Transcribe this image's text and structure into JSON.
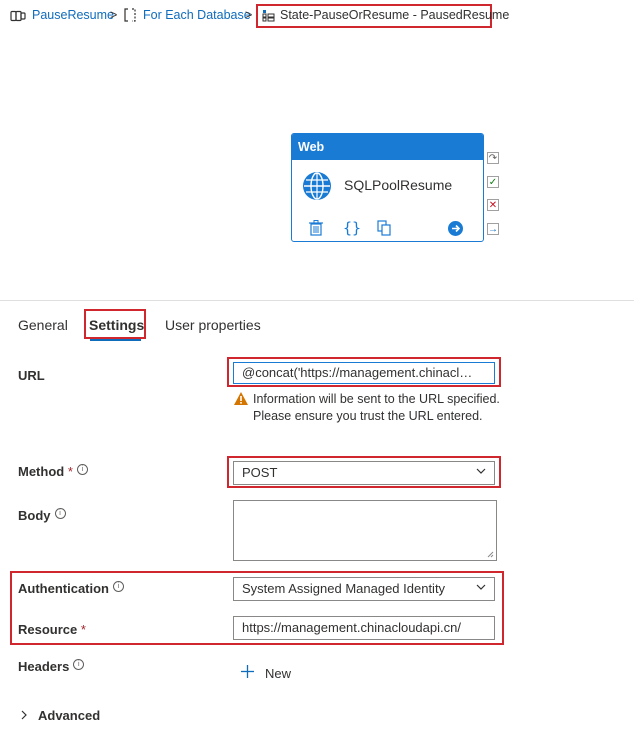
{
  "breadcrumb": {
    "pipeline": "PauseResume",
    "foreach": "For Each Database",
    "current": "State-PauseOrResume - PausedResume",
    "separator": ">"
  },
  "activity": {
    "type": "Web",
    "name": "SQLPoolResume"
  },
  "tabs": [
    {
      "label": "General"
    },
    {
      "label": "Settings",
      "active": true
    },
    {
      "label": "User properties"
    }
  ],
  "form": {
    "url": {
      "label": "URL",
      "value": "@concat('https://management.chinacl…",
      "warning": "Information will be sent to the URL specified. Please ensure you trust the URL entered."
    },
    "method": {
      "label": "Method",
      "required_mark": "*",
      "value": "POST"
    },
    "body": {
      "label": "Body",
      "value": ""
    },
    "authentication": {
      "label": "Authentication",
      "value": "System Assigned Managed Identity"
    },
    "resource": {
      "label": "Resource",
      "required_mark": "*",
      "value": "https://management.chinacloudapi.cn/"
    },
    "headers": {
      "label": "Headers",
      "new_label": "New"
    },
    "advanced": {
      "label": "Advanced"
    }
  },
  "colors": {
    "accent": "#1a7bd4",
    "highlight": "#d0262e",
    "link": "#0f6cbd",
    "required": "#a4262c",
    "warning": "#d47500"
  }
}
